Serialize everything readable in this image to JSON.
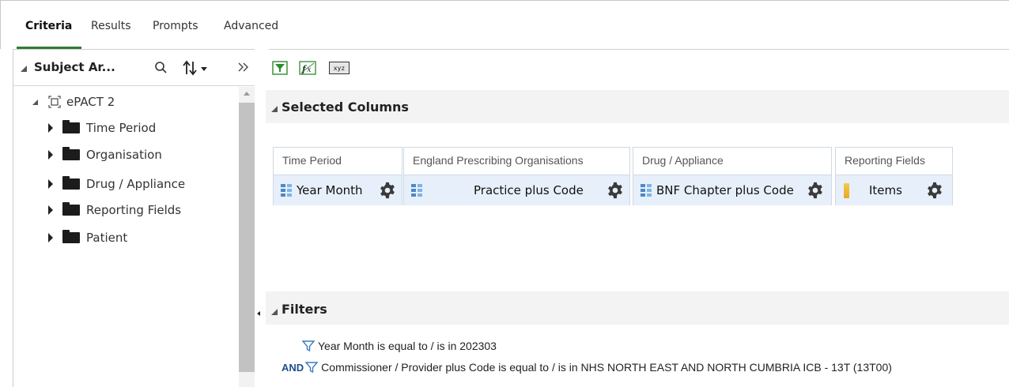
{
  "tabs": [
    {
      "label": "Criteria",
      "active": true
    },
    {
      "label": "Results",
      "active": false
    },
    {
      "label": "Prompts",
      "active": false
    },
    {
      "label": "Advanced",
      "active": false
    }
  ],
  "subject_area": {
    "title": "Subject Ar...",
    "root": "ePACT 2",
    "folders": [
      "Time Period",
      "Organisation",
      "Drug / Appliance",
      "Reporting Fields",
      "Patient"
    ]
  },
  "toolbar": {
    "icons": [
      "filter-icon",
      "add-column-icon",
      "rename-icon"
    ],
    "rename_text": "xyz"
  },
  "selected_columns": {
    "title": "Selected Columns",
    "columns": [
      {
        "folder": "Time Period",
        "label": "Year Month",
        "kind": "attribute"
      },
      {
        "folder": "England Prescribing Organisations",
        "label": "Practice plus Code",
        "kind": "attribute"
      },
      {
        "folder": "Drug / Appliance",
        "label": "BNF Chapter plus Code",
        "kind": "attribute"
      },
      {
        "folder": "Reporting Fields",
        "label": "Items",
        "kind": "measure"
      }
    ]
  },
  "filters": {
    "title": "Filters",
    "items": [
      {
        "operator": "",
        "text": "Year Month is equal to / is in  202303"
      },
      {
        "operator": "AND",
        "text": "Commissioner / Provider plus Code is equal to / is in  NHS NORTH EAST AND NORTH CUMBRIA ICB - 13T (13T00)"
      }
    ]
  },
  "colors": {
    "accent_green": "#2e7d32",
    "column_cell_bg": "#e7f0fa",
    "filter_icon": "#3a7bbf",
    "and_label": "#1f4e8c"
  }
}
